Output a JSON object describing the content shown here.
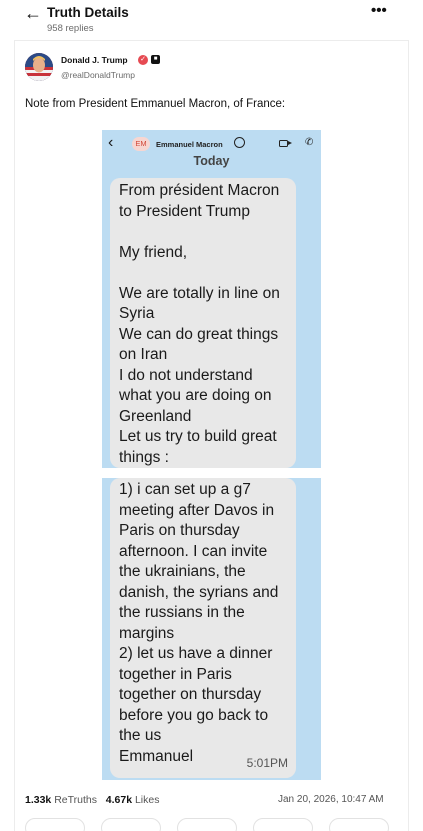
{
  "header": {
    "title": "Truth Details",
    "replies": "958 replies",
    "back_icon": "arrow-left-icon",
    "more_icon": "more-horizontal-icon"
  },
  "post": {
    "author_name": "Donald J. Trump",
    "author_handle": "@realDonaldTrump",
    "text": "Note from President Emmanuel Macron, of France:",
    "verified_color": "#e64a52"
  },
  "screenshot": {
    "contact_badge": "EM",
    "contact_name": "Emmanuel Macron",
    "day_label": "Today",
    "bubble_1_text": "From président Macron\nto President Trump\n\nMy friend,\n\nWe are totally in line on\nSyria\nWe can do great things\non Iran\nI do not understand\nwhat you are doing on\nGreenland\nLet us try to build great\nthings :",
    "bubble_2_text": "1) i can set up a g7\nmeeting after Davos in\nParis on thursday\nafternoon. I can invite\nthe ukrainians, the\ndanish, the syrians and\nthe russians in the\nmargins\n2) let us have a dinner\ntogether in Paris\ntogether on thursday\nbefore you go back to\nthe us\nEmmanuel",
    "time": "5:01PM",
    "background_color": "#bcdcf2",
    "bubble_color": "#e8e8e8"
  },
  "stats": {
    "retruths_count": "1.33k",
    "retruths_label": "ReTruths",
    "likes_count": "4.67k",
    "likes_label": "Likes",
    "date": "Jan 20, 2026, 10:47 AM"
  }
}
